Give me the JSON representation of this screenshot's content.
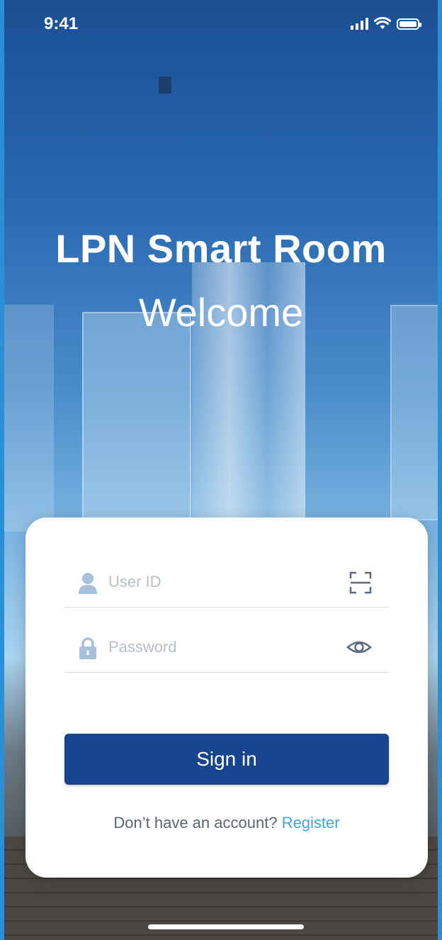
{
  "status_bar": {
    "time": "9:41",
    "icons": [
      "signal-icon",
      "wifi-icon",
      "battery-icon"
    ]
  },
  "header": {
    "title": "LPN Smart Room",
    "subtitle": "Welcome"
  },
  "login": {
    "user_id": {
      "placeholder": "User ID",
      "value": "",
      "icon": "user-icon",
      "action_icon": "scan-icon"
    },
    "password": {
      "placeholder": "Password",
      "value": "",
      "icon": "lock-icon",
      "action_icon": "eye-icon"
    },
    "sign_in_label": "Sign in",
    "register_prompt": "Don’t have an account?",
    "register_link": "Register"
  },
  "colors": {
    "primary": "#18448f",
    "link": "#3ba7db",
    "placeholder": "#b8bec8",
    "icon": "#a7c0de"
  }
}
